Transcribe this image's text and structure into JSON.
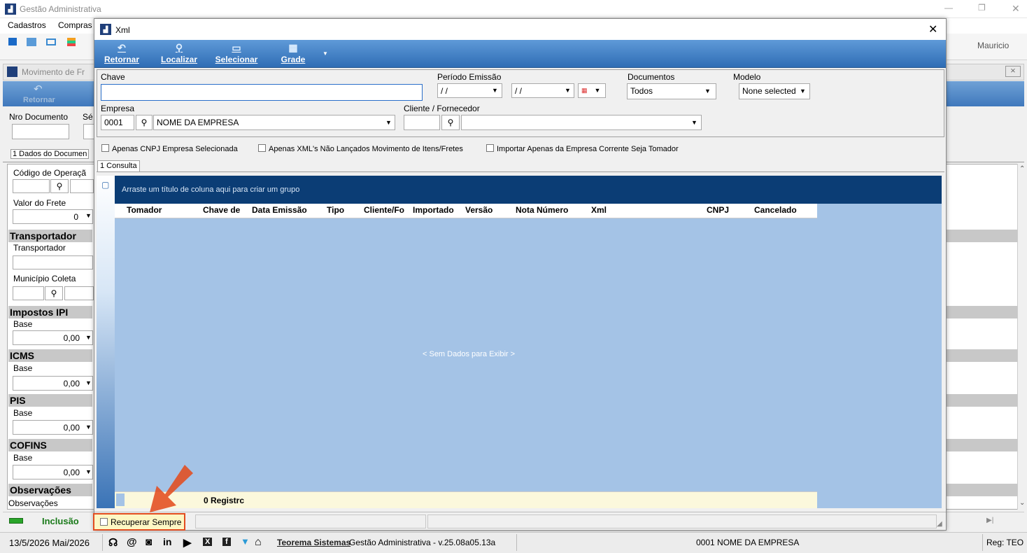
{
  "main_window": {
    "title": "Gestão Administrativa",
    "menu": [
      "Cadastros",
      "Compras"
    ],
    "user": "Mauricio",
    "controls": [
      "—",
      "❐",
      "✕"
    ]
  },
  "bg_form": {
    "title": "Movimento de Fr",
    "retornar": "Retornar",
    "nro_documento": "Nro Documento",
    "serie": "Sé",
    "tab": "1 Dados do Documen",
    "codigo_operacao": "Código de Operaçã",
    "valor_frete": "Valor do Frete",
    "valor_frete_value": "0",
    "sections": [
      {
        "title": "Transportador",
        "field": "Transportador"
      },
      {
        "title": "Impostos IPI",
        "field": "Base",
        "value": "0,00"
      },
      {
        "title": "ICMS",
        "field": "Base",
        "value": "0,00"
      },
      {
        "title": "PIS",
        "field": "Base",
        "value": "0,00"
      },
      {
        "title": "COFINS",
        "field": "Base",
        "value": "0,00"
      },
      {
        "title": "Observações",
        "field": "Observações"
      }
    ],
    "municipio_coleta": "Município Coleta",
    "mode": "Inclusão",
    "nav_end": "▶|"
  },
  "xml_dialog": {
    "title": "Xml",
    "close": "✕",
    "toolbar": [
      {
        "label": "Retornar",
        "icon": "undo-icon"
      },
      {
        "label": "Localizar",
        "icon": "search-icon"
      },
      {
        "label": "Selecionar",
        "icon": "select-icon"
      },
      {
        "label": "Grade",
        "icon": "grid-icon"
      }
    ],
    "filters": {
      "chave_label": "Chave",
      "chave_value": "",
      "periodo_label": "Período Emissão",
      "periodo_from": " / /",
      "periodo_to": " / /",
      "documentos_label": "Documentos",
      "documentos_value": "Todos",
      "modelo_label": "Modelo",
      "modelo_value": "None selected",
      "empresa_label": "Empresa",
      "empresa_code": "0001",
      "empresa_name": "NOME DA EMPRESA",
      "cliente_label": "Cliente / Fornecedor",
      "cliente_code": "",
      "cliente_name": ""
    },
    "checkboxes": [
      "Apenas CNPJ Empresa Selecionada",
      "Apenas XML's Não Lançados Movimento de Itens/Fretes",
      "Importar Apenas da Empresa Corrente Seja Tomador"
    ],
    "tab": "1 Consulta",
    "grid": {
      "group_hint": "Arraste um título de coluna aqui para criar um grupo",
      "columns": [
        "Tomador",
        "Chave de",
        "Data Emissão",
        "Tipo",
        "Cliente/Fo",
        "Importado",
        "Versão",
        "Nota Número",
        "Xml",
        "CNPJ",
        "Cancelado"
      ],
      "empty": "< Sem Dados para Exibir >",
      "footer": "0 Registrc"
    },
    "recuperar": "Recuperar Sempre"
  },
  "statusbar": {
    "date": "13/5/2026 Mai/2026",
    "company_link": "Teorema Sistemas",
    "version": "Gestão Administrativa - v.25.08a05.13a",
    "company": "0001 NOME DA EMPRESA",
    "reg": "Reg: TEO"
  },
  "colors": {
    "accent": "#2f6db5",
    "grid_bg": "#a4c3e6",
    "grid_header": "#0b3d75",
    "highlight": "#e24c1f"
  }
}
